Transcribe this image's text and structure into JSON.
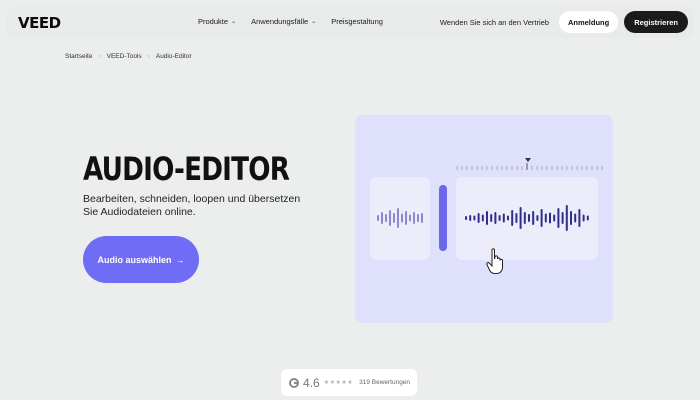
{
  "nav": {
    "logo": "VEED",
    "links": [
      {
        "label": "Produkte",
        "has_dropdown": true
      },
      {
        "label": "Anwendungsfälle",
        "has_dropdown": true
      },
      {
        "label": "Preisgestaltung",
        "has_dropdown": false
      }
    ],
    "contact": "Wenden Sie sich an den Vertrieb",
    "login_label": "Anmeldung",
    "register_label": "Registrieren"
  },
  "breadcrumb": [
    "Startseite",
    "VEED-Tools",
    "Audio-Editor"
  ],
  "hero": {
    "title": "AUDIO-EDITOR",
    "subtitle": "Bearbeiten, schneiden, loopen und übersetzen Sie Audiodateien online.",
    "cta_label": "Audio auswählen",
    "cta_arrow": "→"
  },
  "rating": {
    "value": "4.6",
    "stars": "★★★★★",
    "count_label": "319 Bewertungen"
  },
  "colors": {
    "accent": "#6f6cf5",
    "illustration_bg": "#dfe0fb",
    "wave_dark": "#2e2f8c",
    "wave_light": "#8b8ad0"
  }
}
